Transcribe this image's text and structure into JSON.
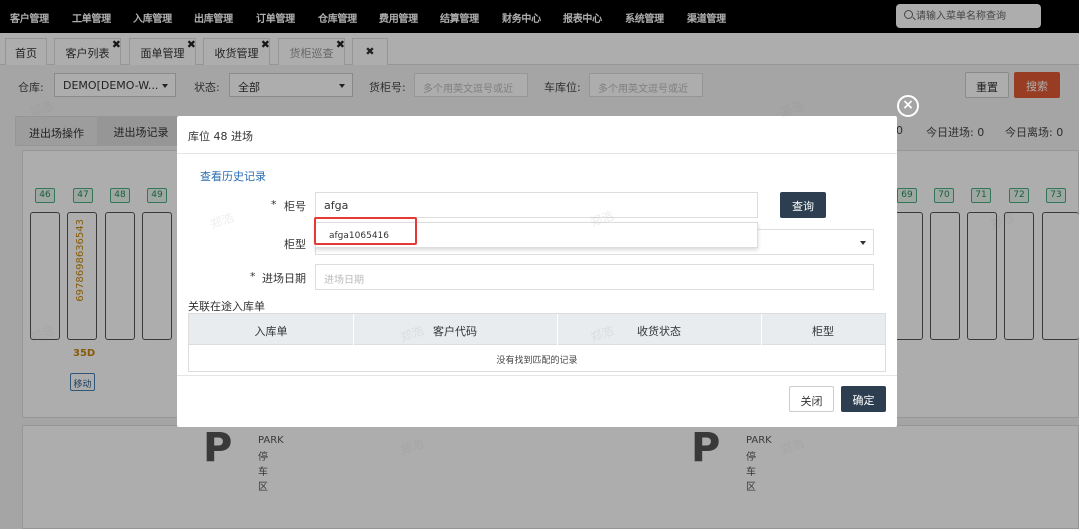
{
  "topnav": {
    "items": [
      "客户管理",
      "工单管理",
      "入库管理",
      "出库管理",
      "订单管理",
      "仓库管理",
      "费用管理",
      "结算管理",
      "财务中心",
      "报表中心",
      "系统管理",
      "渠道管理"
    ],
    "search_placeholder": "请输入菜单名称查询"
  },
  "tabs": [
    {
      "label": "首页",
      "closable": false
    },
    {
      "label": "客户列表",
      "closable": true
    },
    {
      "label": "面单管理",
      "closable": true
    },
    {
      "label": "收货管理",
      "closable": true
    },
    {
      "label": "货柜巡查",
      "closable": true,
      "active": true
    }
  ],
  "close_all_label": "✖",
  "filters": {
    "warehouse_label": "仓库:",
    "warehouse_value": "DEMO[DEMO-W...",
    "status_label": "状态:",
    "status_value": "全部",
    "container_label": "货柜号:",
    "container_placeholder": "多个用英文逗号或近",
    "bay_label": "车库位:",
    "bay_placeholder": "多个用英文逗号或近",
    "reset_label": "重置",
    "search_label": "搜索"
  },
  "subtabs": [
    "进出场操作",
    "进出场记录"
  ],
  "stats": {
    "partial": "0",
    "today_in": "今日进场: 0",
    "today_out": "今日离场: 0"
  },
  "slots_left": [
    "46",
    "47",
    "48",
    "49"
  ],
  "slots_right": [
    "69",
    "70",
    "71",
    "72",
    "73"
  ],
  "slot47": {
    "container": "697869863654​3",
    "size": "35D",
    "move_label": "移动"
  },
  "park": {
    "title": "PARK",
    "subtitle": "停车区",
    "letter": "P"
  },
  "modal": {
    "title": "库位 48 进场",
    "history_link": "查看历史记录",
    "container_label": "柜号",
    "container_value": "afga",
    "query_label": "查询",
    "type_label": "柜型",
    "date_label": "进场日期",
    "date_placeholder": "进场日期",
    "related_title": "关联在途入库单",
    "columns": [
      "入库单",
      "客户代码",
      "收货状态",
      "柜型"
    ],
    "empty_text": "没有找到匹配的记录",
    "close_label": "关闭",
    "confirm_label": "确定",
    "suggestion": "afga1065416"
  },
  "watermark": "郑浩",
  "colors": {
    "accent": "#2c3e50",
    "search": "#e05a35",
    "slot_label": "#c8870c",
    "highlight": "#e53935"
  }
}
